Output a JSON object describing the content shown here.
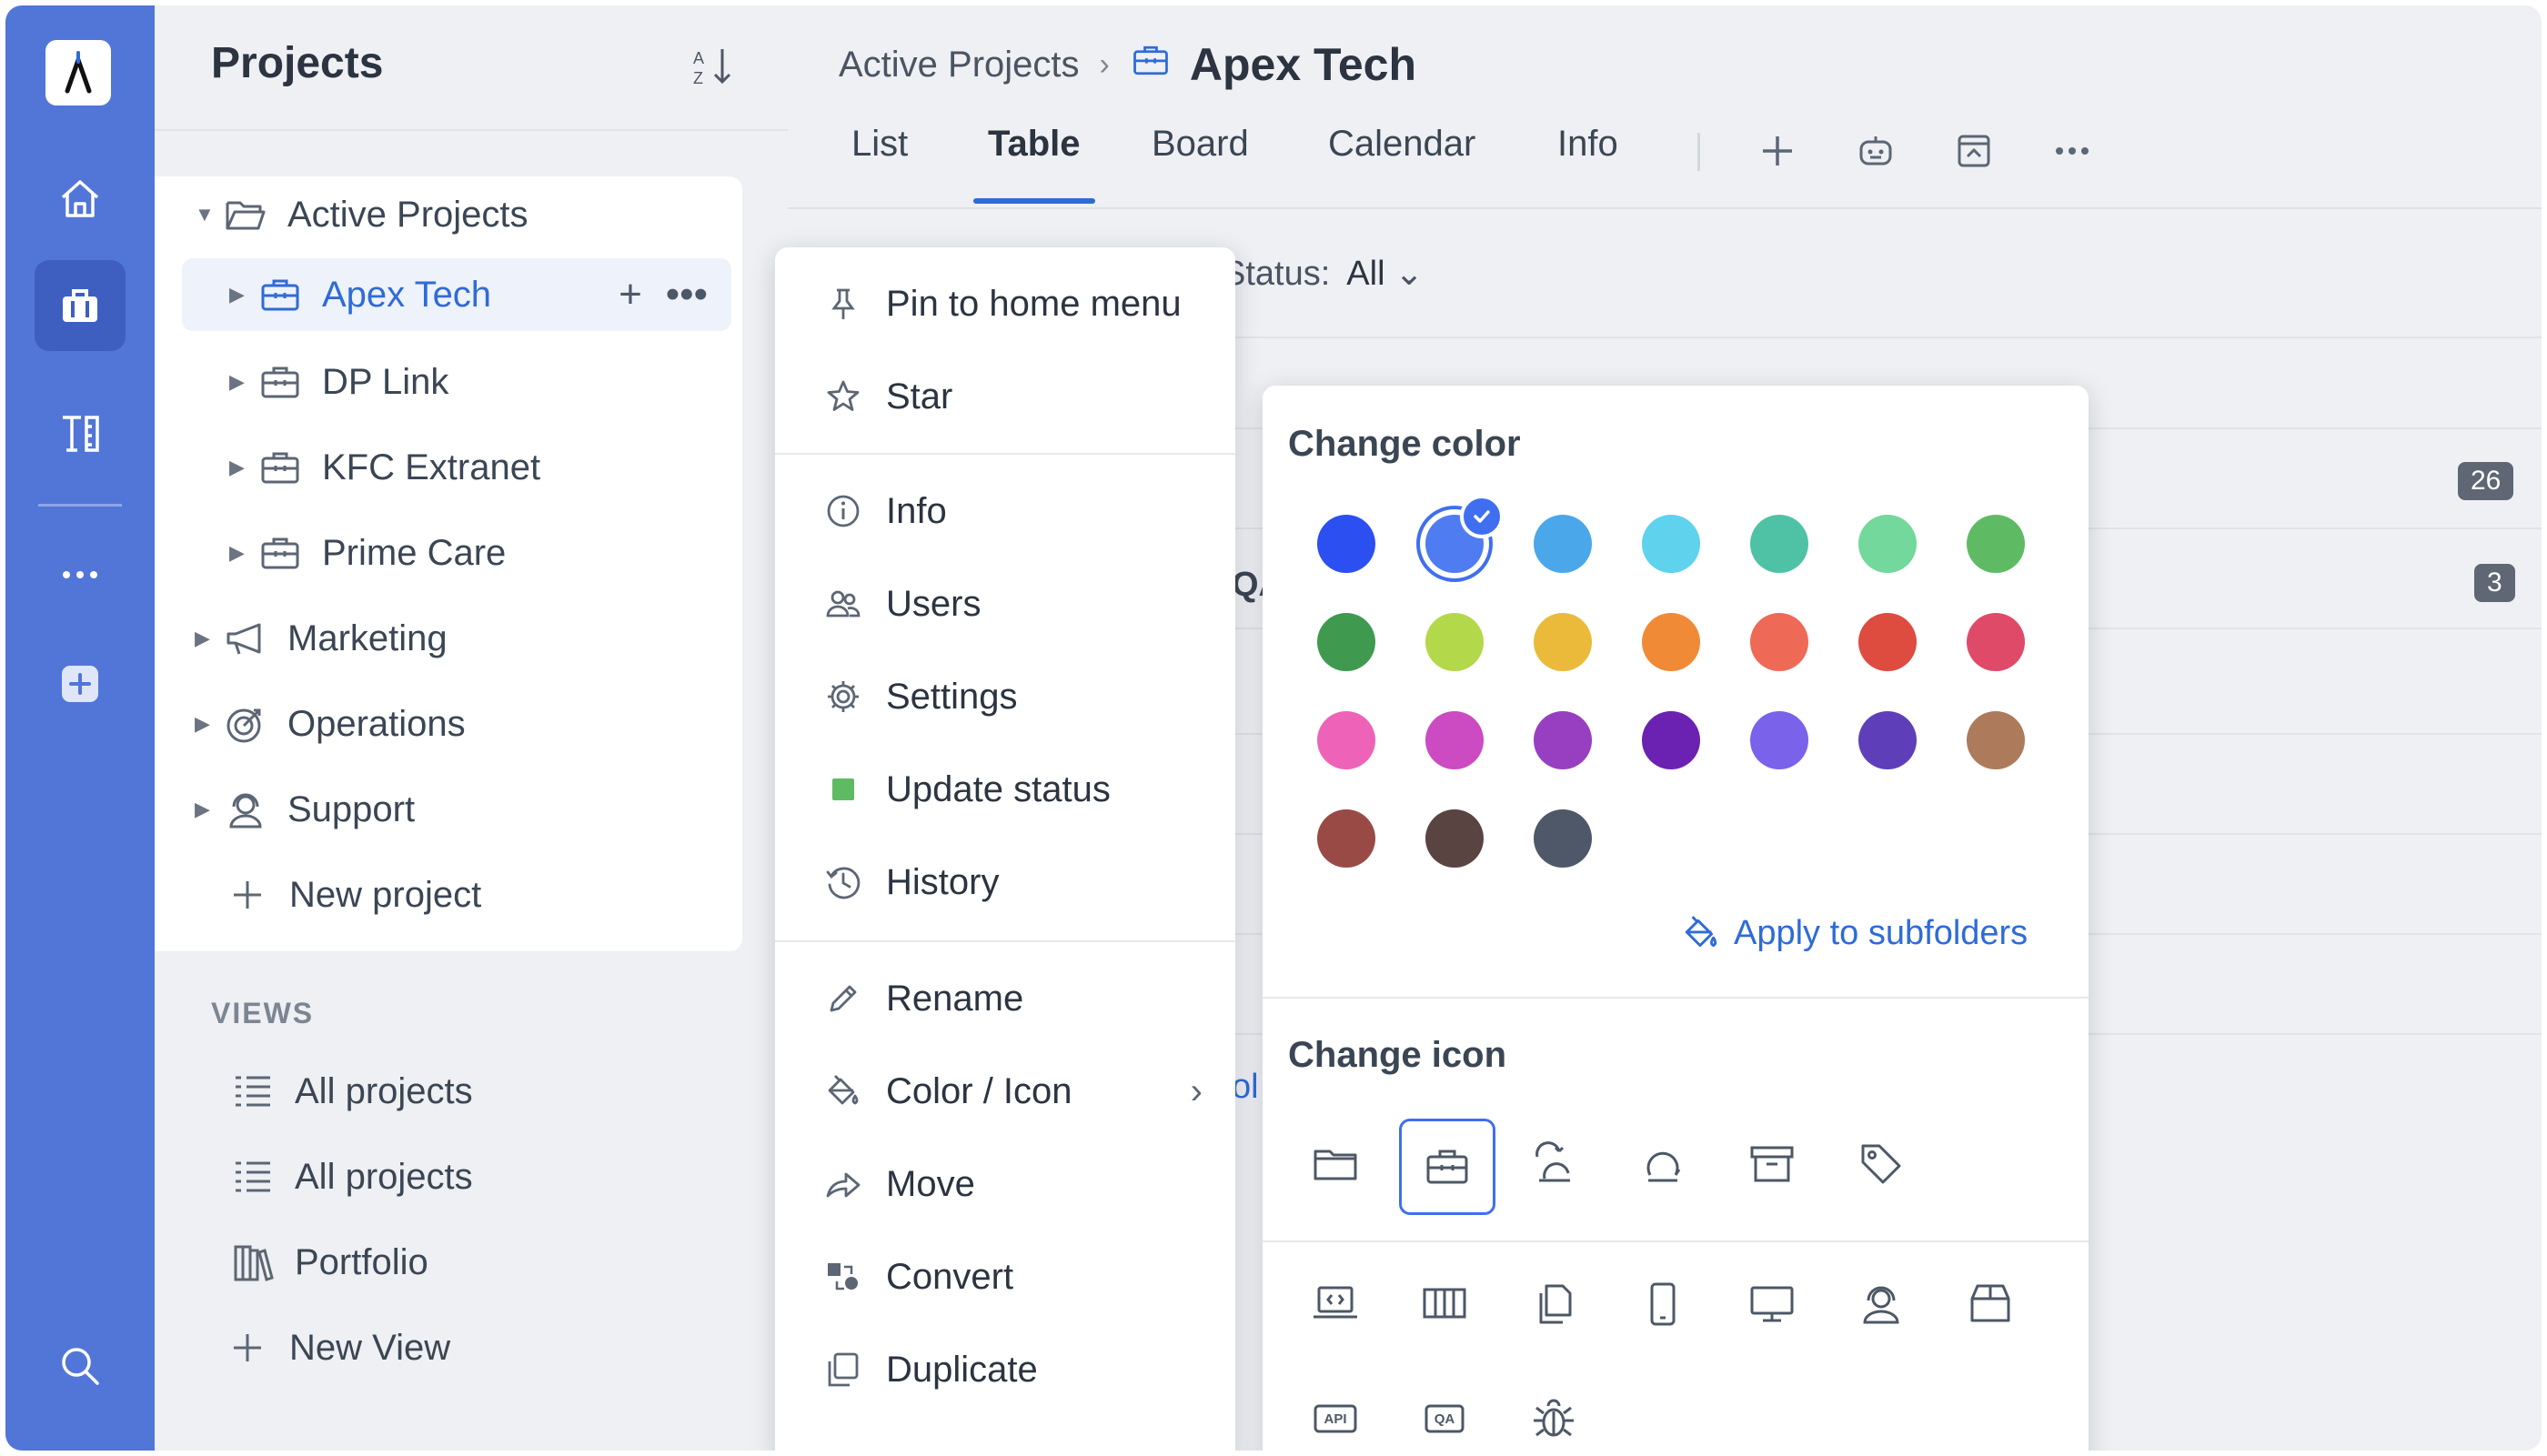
{
  "rail": {
    "icons": [
      "logo-icon",
      "home-icon",
      "briefcase-icon",
      "tools-icon",
      "more-icon",
      "add-icon",
      "search-icon"
    ]
  },
  "sidebar": {
    "title": "Projects",
    "tree": {
      "active_projects": "Active Projects",
      "items": [
        "Apex Tech",
        "DP Link",
        "KFC Extranet",
        "Prime Care"
      ],
      "marketing": "Marketing",
      "operations": "Operations",
      "support": "Support",
      "new_project": "New project"
    },
    "views_heading": "VIEWS",
    "views": [
      "All projects",
      "All projects",
      "Portfolio",
      "New View"
    ]
  },
  "header": {
    "breadcrumb_parent": "Active Projects",
    "breadcrumb_current": "Apex Tech",
    "tabs": [
      "List",
      "Table",
      "Board",
      "Calendar",
      "Info"
    ],
    "active_tab": "Table"
  },
  "main": {
    "status_label": "Status:",
    "status_value": "All",
    "badges": [
      "26",
      "3"
    ],
    "partial_text_1": "QA",
    "partial_text_2": "ol"
  },
  "context_menu": {
    "items": [
      "Pin to home menu",
      "Star",
      "Info",
      "Users",
      "Settings",
      "Update status",
      "History",
      "Rename",
      "Color / Icon",
      "Move",
      "Convert",
      "Duplicate"
    ]
  },
  "submenu": {
    "change_color": "Change color",
    "apply_subfolders": "Apply to subfolders",
    "change_icon": "Change icon",
    "colors": [
      "#2b4ff0",
      "#4f7cf0",
      "#4aa7ea",
      "#5fd2ee",
      "#4fc2a6",
      "#72d89b",
      "#5fbb63",
      "#3f9a4f",
      "#b3d84a",
      "#ebba3a",
      "#f18a36",
      "#ee6a56",
      "#de4b3f",
      "#e04a69",
      "#ee63b8",
      "#cc4ac2",
      "#983fc1",
      "#6b21b1",
      "#7b62ea",
      "#5f3fb9",
      "#ad7a5c",
      "#9a4a45",
      "#5a4442",
      "#4e5868"
    ],
    "selected_color_index": 1,
    "selected_icon": "briefcase-icon",
    "api_label": "API",
    "qa_label": "QA"
  }
}
